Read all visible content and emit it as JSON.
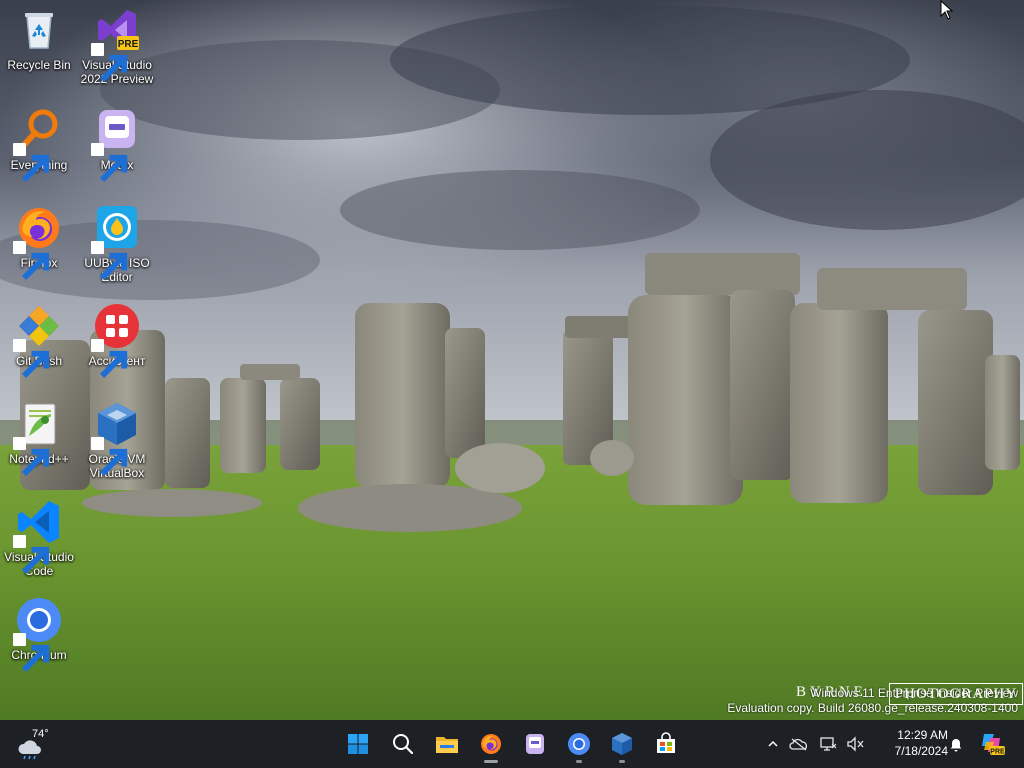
{
  "desktop": {
    "icons": [
      {
        "label": "Recycle Bin",
        "icon": "recycle-bin-icon"
      },
      {
        "label": "Visual Studio 2022 Preview",
        "icon": "visual-studio-preview-icon",
        "badge": "PRE"
      },
      {
        "label": "Everything",
        "icon": "everything-search-icon"
      },
      {
        "label": "Motrix",
        "icon": "motrix-icon"
      },
      {
        "label": "Firefox",
        "icon": "firefox-icon"
      },
      {
        "label": "UUByte ISO Editor",
        "icon": "uubyte-iso-editor-icon"
      },
      {
        "label": "Git Bash",
        "icon": "git-bash-icon"
      },
      {
        "label": "Ассистент",
        "icon": "assistant-icon"
      },
      {
        "label": "Notepad++",
        "icon": "notepad-plus-plus-icon"
      },
      {
        "label": "Oracle VM VirtualBox",
        "icon": "virtualbox-icon"
      },
      {
        "label": "Visual Studio Code",
        "icon": "vscode-icon"
      },
      {
        "label": "Chromium",
        "icon": "chromium-icon"
      }
    ]
  },
  "watermark": {
    "line1": "Windows 11 Enterprise Insider Preview",
    "line2": "Evaluation copy. Build 26080.ge_release.240308-1400",
    "photo_credit_1": "BYRNE",
    "photo_credit_2": "PHOTOGRAPHY"
  },
  "taskbar": {
    "weather": {
      "temp": "74°",
      "icon": "weather-cloud-icon"
    },
    "apps": [
      {
        "name": "start-button",
        "icon": "windows-start-icon"
      },
      {
        "name": "search-button",
        "icon": "search-icon"
      },
      {
        "name": "file-explorer",
        "icon": "file-explorer-icon"
      },
      {
        "name": "firefox",
        "icon": "firefox-icon",
        "running": true
      },
      {
        "name": "motrix",
        "icon": "motrix-icon"
      },
      {
        "name": "chromium",
        "icon": "chromium-icon",
        "running": true
      },
      {
        "name": "virtualbox",
        "icon": "virtualbox-icon",
        "running": true
      },
      {
        "name": "microsoft-store",
        "icon": "store-icon"
      }
    ],
    "tray": {
      "time": "12:29 AM",
      "date": "7/18/2024"
    }
  },
  "colors": {
    "taskbar": "#1d2025",
    "vs_purple": "#7b3fd0",
    "accent_blue": "#0a84ff"
  }
}
